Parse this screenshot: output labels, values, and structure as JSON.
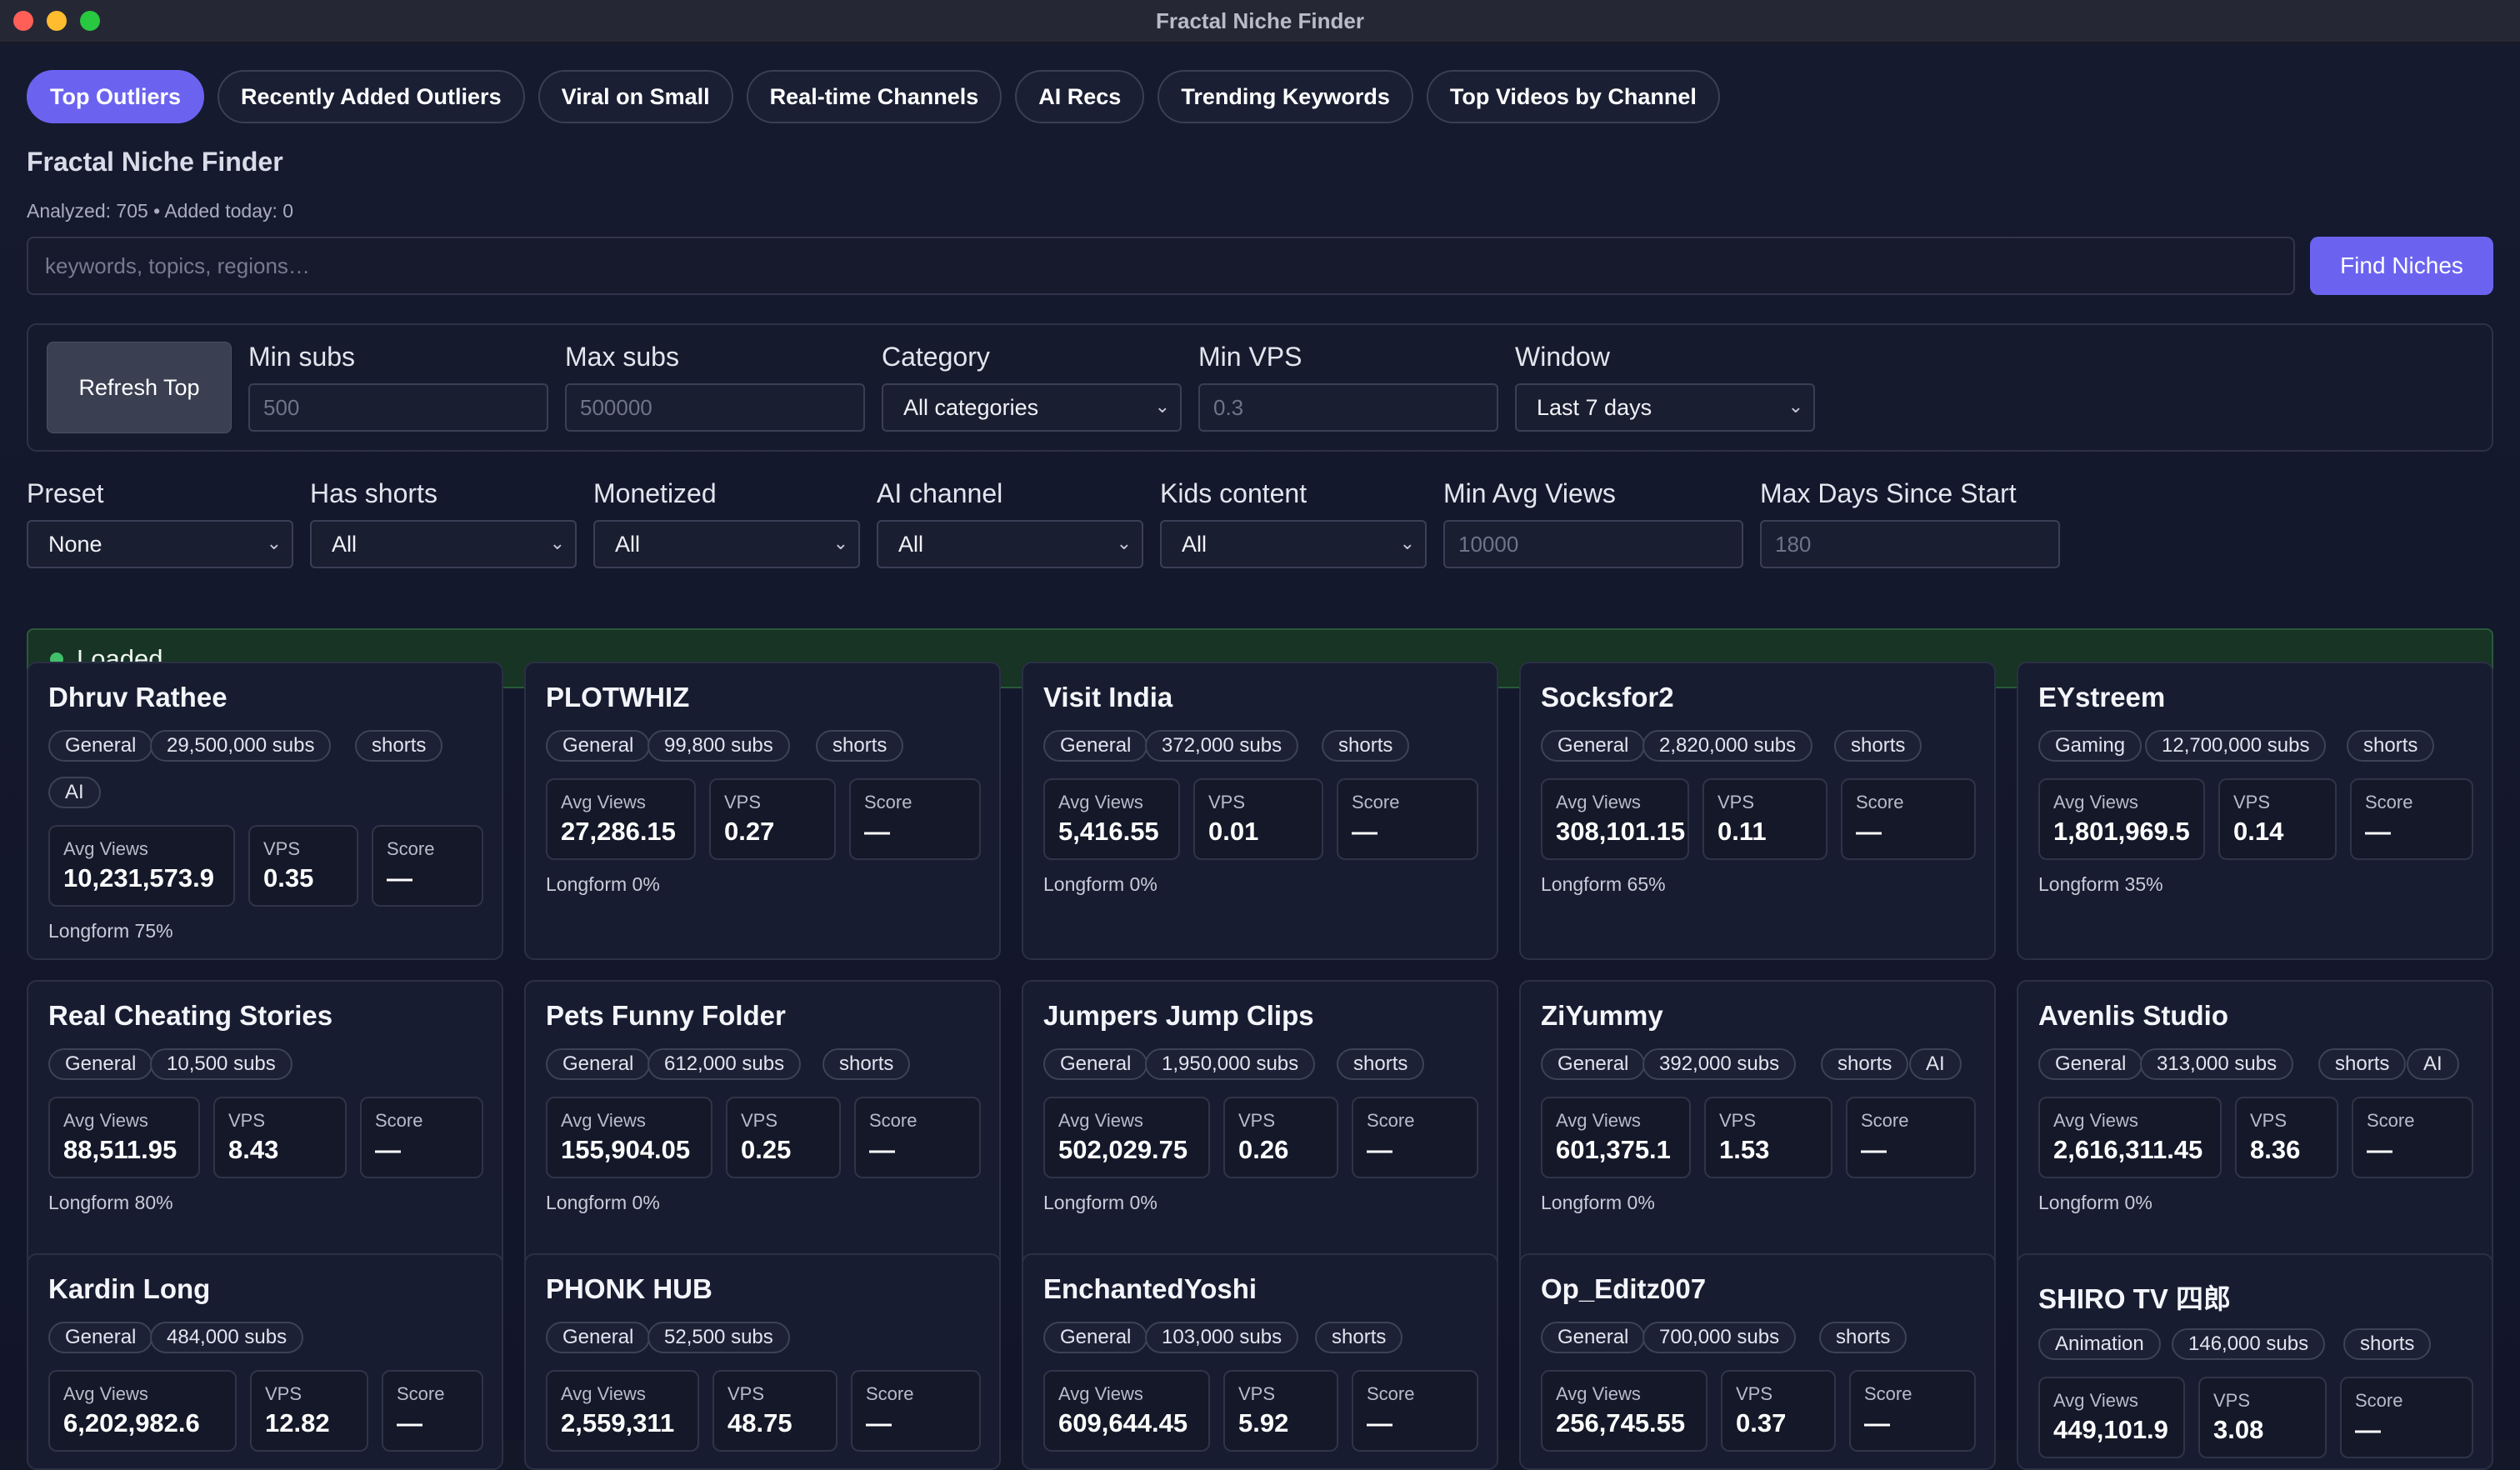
{
  "window": {
    "title": "Fractal Niche Finder"
  },
  "tabs": [
    "Top Outliers",
    "Recently Added Outliers",
    "Viral on Small",
    "Real-time Channels",
    "AI Recs",
    "Trending Keywords",
    "Top Videos by Channel"
  ],
  "active_tab": "Top Outliers",
  "header": {
    "title": "Fractal Niche Finder",
    "stats": "Analyzed: 705 • Added today: 0"
  },
  "search": {
    "placeholder": "keywords, topics, regions…",
    "button": "Find Niches"
  },
  "filters": {
    "refresh_label": "Refresh Top",
    "min_subs_label": "Min subs",
    "min_subs_placeholder": "500",
    "max_subs_label": "Max subs",
    "max_subs_placeholder": "500000",
    "category_label": "Category",
    "category_value": "All categories",
    "min_vps_label": "Min VPS",
    "min_vps_placeholder": "0.3",
    "window_label": "Window",
    "window_value": "Last 7 days",
    "preset_label": "Preset",
    "preset_value": "None",
    "has_shorts_label": "Has shorts",
    "has_shorts_value": "All",
    "monetized_label": "Monetized",
    "monetized_value": "All",
    "ai_channel_label": "AI channel",
    "ai_channel_value": "All",
    "kids_label": "Kids content",
    "kids_value": "All",
    "min_avg_views_label": "Min Avg Views",
    "min_avg_views_placeholder": "10000",
    "max_days_label": "Max Days Since Start",
    "max_days_placeholder": "180"
  },
  "status": {
    "text": "Loaded."
  },
  "metric_labels": {
    "avg_views": "Avg Views",
    "vps": "VPS",
    "score": "Score"
  },
  "cards": [
    {
      "name": "Dhruv Rathee",
      "category": "General",
      "subs": "29,500,000 subs",
      "shorts": "shorts",
      "ai": "AI",
      "avg_views": "10,231,573.9",
      "vps": "0.35",
      "score": "—",
      "longform": "Longform 75%"
    },
    {
      "name": "PLOTWHIZ",
      "category": "General",
      "subs": "99,800 subs",
      "shorts": "shorts",
      "avg_views": "27,286.15",
      "vps": "0.27",
      "score": "—",
      "longform": "Longform 0%"
    },
    {
      "name": "Visit India",
      "category": "General",
      "subs": "372,000 subs",
      "shorts": "shorts",
      "avg_views": "5,416.55",
      "vps": "0.01",
      "score": "—",
      "longform": "Longform 0%"
    },
    {
      "name": "Socksfor2",
      "category": "General",
      "subs": "2,820,000 subs",
      "shorts": "shorts",
      "avg_views": "308,101.15",
      "vps": "0.11",
      "score": "—",
      "longform": "Longform 65%"
    },
    {
      "name": "EYstreem",
      "category": "Gaming",
      "subs": "12,700,000 subs",
      "shorts": "shorts",
      "avg_views": "1,801,969.5",
      "vps": "0.14",
      "score": "—",
      "longform": "Longform 35%"
    },
    {
      "name": "Real Cheating Stories",
      "category": "General",
      "subs": "10,500 subs",
      "avg_views": "88,511.95",
      "vps": "8.43",
      "score": "—",
      "longform": "Longform 80%"
    },
    {
      "name": "Pets Funny Folder",
      "category": "General",
      "subs": "612,000 subs",
      "shorts": "shorts",
      "avg_views": "155,904.05",
      "vps": "0.25",
      "score": "—",
      "longform": "Longform 0%"
    },
    {
      "name": "Jumpers Jump Clips",
      "category": "General",
      "subs": "1,950,000 subs",
      "shorts": "shorts",
      "avg_views": "502,029.75",
      "vps": "0.26",
      "score": "—",
      "longform": "Longform 0%"
    },
    {
      "name": "ZiYummy",
      "category": "General",
      "subs": "392,000 subs",
      "shorts": "shorts",
      "ai": "AI",
      "avg_views": "601,375.1",
      "vps": "1.53",
      "score": "—",
      "longform": "Longform 0%"
    },
    {
      "name": "Avenlis Studio",
      "category": "General",
      "subs": "313,000 subs",
      "shorts": "shorts",
      "ai": "AI",
      "avg_views": "2,616,311.45",
      "vps": "8.36",
      "score": "—",
      "longform": "Longform 0%"
    },
    {
      "name": "Kardin Long",
      "category": "General",
      "subs": "484,000 subs",
      "avg_views": "6,202,982.6",
      "vps": "12.82",
      "score": "—"
    },
    {
      "name": "PHONK HUB",
      "category": "General",
      "subs": "52,500 subs",
      "avg_views": "2,559,311",
      "vps": "48.75",
      "score": "—"
    },
    {
      "name": "EnchantedYoshi",
      "category": "General",
      "subs": "103,000 subs",
      "shorts": "shorts",
      "avg_views": "609,644.45",
      "vps": "5.92",
      "score": "—"
    },
    {
      "name": "Op_Editz007",
      "category": "General",
      "subs": "700,000 subs",
      "shorts": "shorts",
      "avg_views": "256,745.55",
      "vps": "0.37",
      "score": "—"
    },
    {
      "name": "SHIRO TV 四郎",
      "category": "Animation",
      "subs": "146,000 subs",
      "shorts": "shorts",
      "avg_views": "449,101.9",
      "vps": "3.08",
      "score": "—"
    }
  ]
}
